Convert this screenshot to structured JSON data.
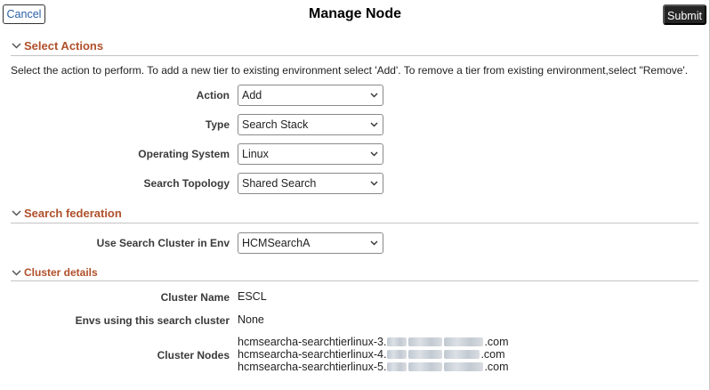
{
  "header": {
    "title": "Manage Node",
    "cancel_label": "Cancel",
    "submit_label": "Submit"
  },
  "sections": {
    "select_actions": {
      "title": "Select Actions",
      "instructions": "Select the action to perform. To add a new tier to existing environment select 'Add'. To remove a tier from existing environment,select \"Remove'.",
      "fields": {
        "action": {
          "label": "Action",
          "value": "Add"
        },
        "type": {
          "label": "Type",
          "value": "Search Stack"
        },
        "os": {
          "label": "Operating System",
          "value": "Linux"
        },
        "topology": {
          "label": "Search Topology",
          "value": "Shared Search"
        }
      }
    },
    "search_federation": {
      "title": "Search federation",
      "fields": {
        "cluster": {
          "label": "Use Search Cluster in Env",
          "value": "HCMSearchA"
        }
      }
    },
    "cluster_details": {
      "title": "Cluster details",
      "cluster_name": {
        "label": "Cluster Name",
        "value": "ESCL"
      },
      "envs_using": {
        "label": "Envs using this search cluster",
        "value": "None"
      },
      "cluster_nodes": {
        "label": "Cluster Nodes",
        "nodes": [
          {
            "prefix": "hcmsearcha-searchtierlinux-3.",
            "suffix": ".com"
          },
          {
            "prefix": "hcmsearcha-searchtierlinux-4.",
            "suffix": ".com"
          },
          {
            "prefix": "hcmsearcha-searchtierlinux-5.",
            "suffix": ".com"
          }
        ]
      }
    }
  },
  "icons": {
    "section_toggle": "chevron-down-icon",
    "dropdown": "caret-down-icon"
  },
  "colors": {
    "section_title": "#b0502b",
    "cancel_text": "#2a5fa8",
    "submit_bg": "#252525"
  }
}
